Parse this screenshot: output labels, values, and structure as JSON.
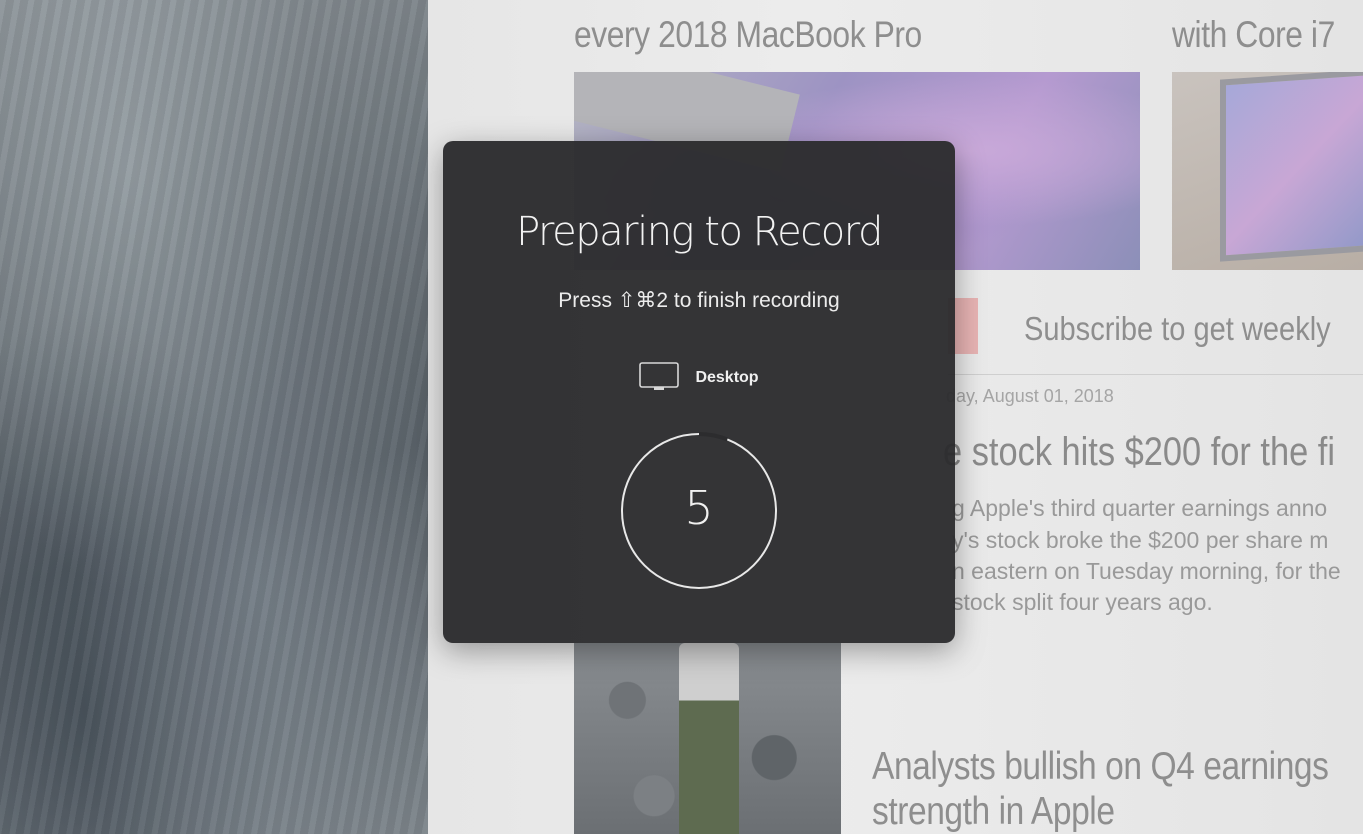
{
  "background_page": {
    "headline_left": "every 2018 MacBook Pro",
    "headline_right": "with Core i7",
    "subscribe_text": "Subscribe to get weekly",
    "article_date": "day, August 01, 2018",
    "article_title": "e stock hits $200 for the fi",
    "article_lines": [
      "g Apple's third quarter earnings anno",
      "y's stock broke the $200 per share m",
      "n eastern on Tuesday morning, for the",
      "stock split four years ago."
    ],
    "bottom_headline_lines": [
      "Analysts bullish on Q4 earnings",
      "strength in Apple"
    ]
  },
  "record_panel": {
    "title": "Preparing to Record",
    "shortcut_text": "Press ⇧⌘2 to finish recording",
    "target_label": "Desktop",
    "target_icon": "monitor-icon",
    "countdown_value": "5",
    "countdown_progress": 0.06
  }
}
